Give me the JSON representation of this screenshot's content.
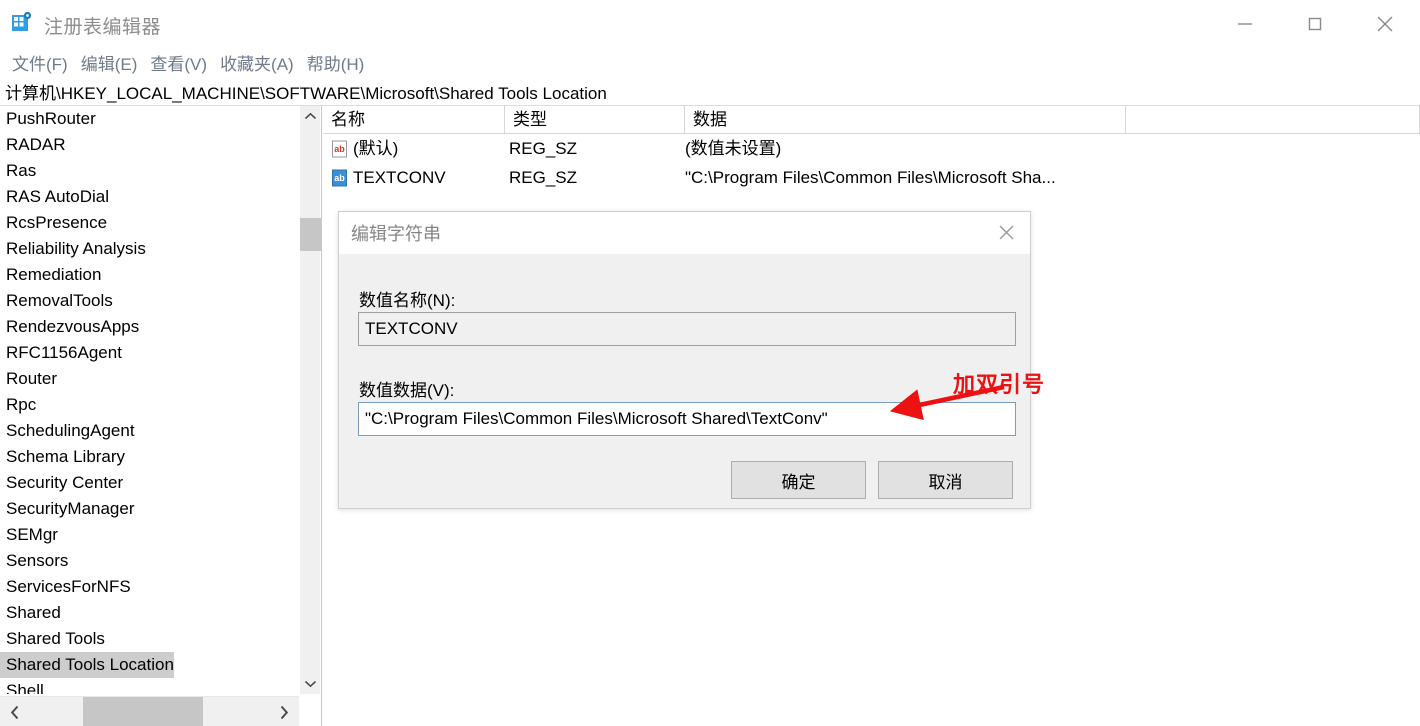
{
  "window": {
    "title": "注册表编辑器",
    "icon": "registry-editor-icon",
    "minimize_label": "最小化",
    "maximize_label": "最大化",
    "close_label": "关闭"
  },
  "menubar": {
    "items": [
      {
        "label": "文件(F)",
        "name": "menu-file"
      },
      {
        "label": "编辑(E)",
        "name": "menu-edit"
      },
      {
        "label": "查看(V)",
        "name": "menu-view"
      },
      {
        "label": "收藏夹(A)",
        "name": "menu-favorites"
      },
      {
        "label": "帮助(H)",
        "name": "menu-help"
      }
    ]
  },
  "address": {
    "path": "计算机\\HKEY_LOCAL_MACHINE\\SOFTWARE\\Microsoft\\Shared Tools Location"
  },
  "tree": {
    "items": [
      {
        "label": "PushRouter",
        "selected": false
      },
      {
        "label": "RADAR",
        "selected": false
      },
      {
        "label": "Ras",
        "selected": false
      },
      {
        "label": "RAS AutoDial",
        "selected": false
      },
      {
        "label": "RcsPresence",
        "selected": false
      },
      {
        "label": "Reliability Analysis",
        "selected": false
      },
      {
        "label": "Remediation",
        "selected": false
      },
      {
        "label": "RemovalTools",
        "selected": false
      },
      {
        "label": "RendezvousApps",
        "selected": false
      },
      {
        "label": "RFC1156Agent",
        "selected": false
      },
      {
        "label": "Router",
        "selected": false
      },
      {
        "label": "Rpc",
        "selected": false
      },
      {
        "label": "SchedulingAgent",
        "selected": false
      },
      {
        "label": "Schema Library",
        "selected": false
      },
      {
        "label": "Security Center",
        "selected": false
      },
      {
        "label": "SecurityManager",
        "selected": false
      },
      {
        "label": "SEMgr",
        "selected": false
      },
      {
        "label": "Sensors",
        "selected": false
      },
      {
        "label": "ServicesForNFS",
        "selected": false
      },
      {
        "label": "Shared",
        "selected": false
      },
      {
        "label": "Shared Tools",
        "selected": false
      },
      {
        "label": "Shared Tools Location",
        "selected": true
      },
      {
        "label": "Shell",
        "selected": false
      }
    ]
  },
  "list": {
    "columns": [
      "名称",
      "类型",
      "数据"
    ],
    "rows": [
      {
        "icon": "string-value-default-icon",
        "name": "(默认)",
        "type": "REG_SZ",
        "data": "(数值未设置)"
      },
      {
        "icon": "string-value-icon",
        "name": "TEXTCONV",
        "type": "REG_SZ",
        "data": "\"C:\\Program Files\\Common Files\\Microsoft Sha..."
      }
    ]
  },
  "dialog": {
    "title": "编辑字符串",
    "close_label": "关闭",
    "name_label": "数值名称(N):",
    "name_value": "TEXTCONV",
    "data_label": "数值数据(V):",
    "data_value": "\"C:\\Program Files\\Common Files\\Microsoft Shared\\TextConv\"",
    "ok_label": "确定",
    "cancel_label": "取消"
  },
  "annotation": {
    "text": "加双引号",
    "color": "#ee1111"
  },
  "colors": {
    "selection": "#cdcdcd",
    "menu_text": "#6f7b8b",
    "dialog_bg": "#f0f0f0",
    "focus_border": "#7a9ebb"
  }
}
